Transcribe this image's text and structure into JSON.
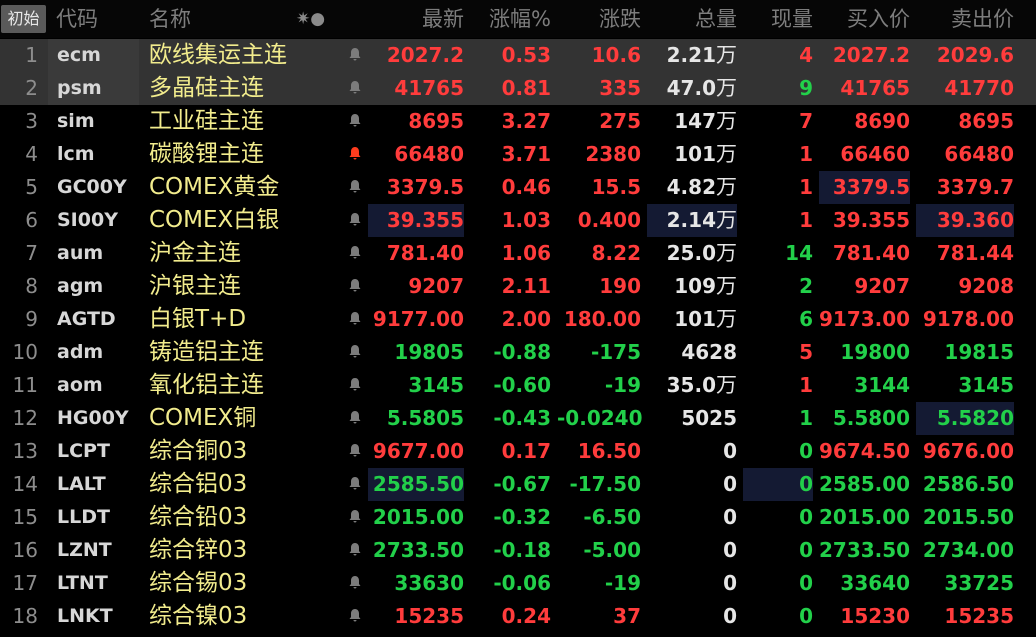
{
  "colors": {
    "up": "#ff3c3c",
    "down": "#22d04a",
    "flat": "#e6e6e6",
    "name": "#f2ec8d",
    "bell_active": "#ff3c1e",
    "bell_inactive": "#7c7c7c"
  },
  "header": {
    "reset_label": "初始",
    "code": "代码",
    "name": "名称",
    "gear": "✷●",
    "last": "最新",
    "pct": "涨幅%",
    "change": "涨跌",
    "volume": "总量",
    "cur_volume": "现量",
    "bid": "买入价",
    "ask": "卖出价"
  },
  "rows": [
    {
      "idx": "1",
      "code": "ecm",
      "name": "欧线集运主连",
      "last": "2027.2",
      "pct": "0.53",
      "change": "10.6",
      "vol": "2.21",
      "vol_unit": "万",
      "cur": "4",
      "bid": "2027.2",
      "ask": "2029.6",
      "dir": "up",
      "bell": "inactive",
      "selected": true
    },
    {
      "idx": "2",
      "code": "psm",
      "name": "多晶硅主连",
      "last": "41765",
      "pct": "0.81",
      "change": "335",
      "vol": "47.0",
      "vol_unit": "万",
      "cur": "9",
      "cur_dir": "down",
      "bid": "41765",
      "ask": "41770",
      "dir": "up",
      "bell": "inactive",
      "selected": true
    },
    {
      "idx": "3",
      "code": "sim",
      "name": "工业硅主连",
      "last": "8695",
      "pct": "3.27",
      "change": "275",
      "vol": "147",
      "vol_unit": "万",
      "cur": "7",
      "bid": "8690",
      "ask": "8695",
      "dir": "up",
      "bell": "inactive"
    },
    {
      "idx": "4",
      "code": "lcm",
      "name": "碳酸锂主连",
      "last": "66480",
      "pct": "3.71",
      "change": "2380",
      "vol": "101",
      "vol_unit": "万",
      "cur": "1",
      "bid": "66460",
      "ask": "66480",
      "dir": "up",
      "bell": "active"
    },
    {
      "idx": "5",
      "code": "GC00Y",
      "name": "COMEX黄金",
      "last": "3379.5",
      "pct": "0.46",
      "change": "15.5",
      "vol": "4.82",
      "vol_unit": "万",
      "cur": "1",
      "bid": "3379.5",
      "ask": "3379.7",
      "dir": "up",
      "bell": "inactive",
      "hl_bid": true
    },
    {
      "idx": "6",
      "code": "SI00Y",
      "name": "COMEX白银",
      "last": "39.355",
      "pct": "1.03",
      "change": "0.400",
      "vol": "2.14",
      "vol_unit": "万",
      "cur": "1",
      "bid": "39.355",
      "ask": "39.360",
      "dir": "up",
      "bell": "inactive",
      "hl_last": true,
      "hl_vol": true,
      "hl_ask": true
    },
    {
      "idx": "7",
      "code": "aum",
      "name": "沪金主连",
      "last": "781.40",
      "pct": "1.06",
      "change": "8.22",
      "vol": "25.0",
      "vol_unit": "万",
      "cur": "14",
      "cur_dir": "down",
      "bid": "781.40",
      "ask": "781.44",
      "dir": "up",
      "bell": "inactive"
    },
    {
      "idx": "8",
      "code": "agm",
      "name": "沪银主连",
      "last": "9207",
      "pct": "2.11",
      "change": "190",
      "vol": "109",
      "vol_unit": "万",
      "cur": "2",
      "cur_dir": "down",
      "bid": "9207",
      "ask": "9208",
      "dir": "up",
      "bell": "inactive"
    },
    {
      "idx": "9",
      "code": "AGTD",
      "name": "白银T+D",
      "last": "9177.00",
      "pct": "2.00",
      "change": "180.00",
      "vol": "101",
      "vol_unit": "万",
      "cur": "6",
      "cur_dir": "down",
      "bid": "9173.00",
      "ask": "9178.00",
      "dir": "up",
      "bell": "inactive"
    },
    {
      "idx": "10",
      "code": "adm",
      "name": "铸造铝主连",
      "last": "19805",
      "pct": "-0.88",
      "change": "-175",
      "vol": "4628",
      "vol_unit": "",
      "cur": "5",
      "cur_dir": "up",
      "bid": "19800",
      "ask": "19815",
      "dir": "down",
      "bell": "inactive"
    },
    {
      "idx": "11",
      "code": "aom",
      "name": "氧化铝主连",
      "last": "3145",
      "pct": "-0.60",
      "change": "-19",
      "vol": "35.0",
      "vol_unit": "万",
      "cur": "1",
      "cur_dir": "up",
      "bid": "3144",
      "ask": "3145",
      "dir": "down",
      "bell": "inactive"
    },
    {
      "idx": "12",
      "code": "HG00Y",
      "name": "COMEX铜",
      "last": "5.5805",
      "pct": "-0.43",
      "change": "-0.0240",
      "vol": "5025",
      "vol_unit": "",
      "cur": "1",
      "cur_dir": "down",
      "bid": "5.5800",
      "ask": "5.5820",
      "dir": "down",
      "bell": "inactive",
      "hl_ask": true
    },
    {
      "idx": "13",
      "code": "LCPT",
      "name": "综合铜03",
      "last": "9677.00",
      "pct": "0.17",
      "change": "16.50",
      "vol": "0",
      "vol_unit": "",
      "cur": "0",
      "cur_dir": "down",
      "bid": "9674.50",
      "ask": "9676.00",
      "dir": "up",
      "bell": "inactive"
    },
    {
      "idx": "14",
      "code": "LALT",
      "name": "综合铝03",
      "last": "2585.50",
      "pct": "-0.67",
      "change": "-17.50",
      "vol": "0",
      "vol_unit": "",
      "cur": "0",
      "cur_dir": "down",
      "bid": "2585.00",
      "ask": "2586.50",
      "dir": "down",
      "bell": "inactive",
      "hl_last": true,
      "hl_cur": true
    },
    {
      "idx": "15",
      "code": "LLDT",
      "name": "综合铅03",
      "last": "2015.00",
      "pct": "-0.32",
      "change": "-6.50",
      "vol": "0",
      "vol_unit": "",
      "cur": "0",
      "cur_dir": "down",
      "bid": "2015.00",
      "ask": "2015.50",
      "dir": "down",
      "bell": "inactive"
    },
    {
      "idx": "16",
      "code": "LZNT",
      "name": "综合锌03",
      "last": "2733.50",
      "pct": "-0.18",
      "change": "-5.00",
      "vol": "0",
      "vol_unit": "",
      "cur": "0",
      "cur_dir": "down",
      "bid": "2733.50",
      "ask": "2734.00",
      "dir": "down",
      "bell": "inactive"
    },
    {
      "idx": "17",
      "code": "LTNT",
      "name": "综合锡03",
      "last": "33630",
      "pct": "-0.06",
      "change": "-19",
      "vol": "0",
      "vol_unit": "",
      "cur": "0",
      "cur_dir": "down",
      "bid": "33640",
      "ask": "33725",
      "dir": "down",
      "bell": "inactive"
    },
    {
      "idx": "18",
      "code": "LNKT",
      "name": "综合镍03",
      "last": "15235",
      "pct": "0.24",
      "change": "37",
      "vol": "0",
      "vol_unit": "",
      "cur": "0",
      "cur_dir": "down",
      "bid": "15230",
      "ask": "15235",
      "dir": "up",
      "bell": "inactive"
    }
  ]
}
